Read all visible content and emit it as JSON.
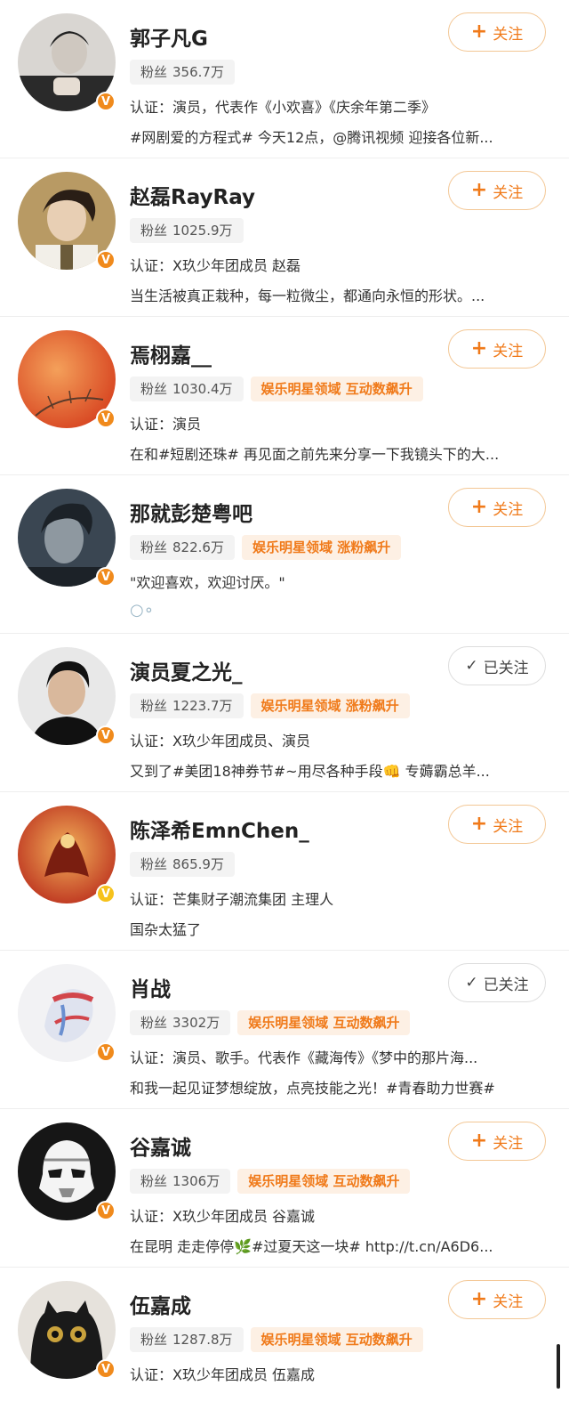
{
  "users": [
    {
      "name": "郭子凡G",
      "fans_label": "粉丝",
      "fans": "356.7万",
      "tags": [],
      "line1": "认证：演员，代表作《小欢喜》《庆余年第二季》",
      "line2": "#网剧爱的方程式# 今天12点，@腾讯视频 迎接各位新...",
      "button_icon": "+",
      "button_label": "关注",
      "following": false,
      "badge": "orange"
    },
    {
      "name": "赵磊RayRay",
      "fans_label": "粉丝",
      "fans": "1025.9万",
      "tags": [],
      "line1": "认证：X玖少年团成员 赵磊",
      "line2": "当生活被真正栽种，每一粒微尘，都通向永恒的形状。...",
      "button_icon": "+",
      "button_label": "关注",
      "following": false,
      "badge": "orange"
    },
    {
      "name": "焉栩嘉__",
      "fans_label": "粉丝",
      "fans": "1030.4万",
      "tags": [
        "娱乐明星领域",
        "互动数飙升"
      ],
      "line1": "认证：演员",
      "line2": "在和#短剧还珠# 再见面之前先来分享一下我镜头下的大...",
      "button_icon": "+",
      "button_label": "关注",
      "following": false,
      "badge": "orange"
    },
    {
      "name": "那就彭楚粤吧",
      "fans_label": "粉丝",
      "fans": "822.6万",
      "tags": [
        "娱乐明星领域",
        "涨粉飙升"
      ],
      "line1": "\"欢迎喜欢，欢迎讨厌。\"",
      "line2": "",
      "line2_icon": "bubble-icon",
      "button_icon": "+",
      "button_label": "关注",
      "following": false,
      "badge": "orange"
    },
    {
      "name": "演员夏之光_",
      "fans_label": "粉丝",
      "fans": "1223.7万",
      "tags": [
        "娱乐明星领域",
        "涨粉飙升"
      ],
      "line1": "认证：X玖少年团成员、演员",
      "line2": "又到了#美团18神券节#~用尽各种手段👊 专薅霸总羊...",
      "button_icon": "✓",
      "button_label": "已关注",
      "following": true,
      "badge": "orange"
    },
    {
      "name": "陈泽希EmnChen_",
      "fans_label": "粉丝",
      "fans": "865.9万",
      "tags": [],
      "line1": "认证：芒集财子潮流集团 主理人",
      "line2": "国杂太猛了",
      "button_icon": "+",
      "button_label": "关注",
      "following": false,
      "badge": "yellow"
    },
    {
      "name": "肖战",
      "fans_label": "粉丝",
      "fans": "3302万",
      "tags": [
        "娱乐明星领域",
        "互动数飙升"
      ],
      "line1": "认证：演员、歌手。代表作《藏海传》《梦中的那片海...",
      "line2": "和我一起见证梦想绽放，点亮技能之光！#青春助力世赛#",
      "button_icon": "✓",
      "button_label": "已关注",
      "following": true,
      "badge": "orange"
    },
    {
      "name": "谷嘉诚",
      "fans_label": "粉丝",
      "fans": "1306万",
      "tags": [
        "娱乐明星领域",
        "互动数飙升"
      ],
      "line1": "认证：X玖少年团成员 谷嘉诚",
      "line2": "在昆明 走走停停🌿#过夏天这一块# http://t.cn/A6D6...",
      "button_icon": "+",
      "button_label": "关注",
      "following": false,
      "badge": "orange"
    },
    {
      "name": "伍嘉成",
      "fans_label": "粉丝",
      "fans": "1287.8万",
      "tags": [
        "娱乐明星领域",
        "互动数飙升"
      ],
      "line1": "认证：X玖少年团成员 伍嘉成",
      "line2": "",
      "button_icon": "+",
      "button_label": "关注",
      "following": false,
      "badge": "orange"
    }
  ],
  "avatar_colors": [
    [
      "#2a2a2a",
      "#d9d6d2"
    ],
    [
      "#6b5b3a",
      "#2a1e16"
    ],
    [
      "#e0572a",
      "#f4a05a"
    ],
    [
      "#3a4652",
      "#1c2228"
    ],
    [
      "#e8e8e8",
      "#111111"
    ],
    [
      "#c8321e",
      "#f2b15a"
    ],
    [
      "#f2f2f4",
      "#d2454b"
    ],
    [
      "#161616",
      "#f4f4f4"
    ],
    [
      "#1a1a1a",
      "#8b8b8b"
    ]
  ]
}
